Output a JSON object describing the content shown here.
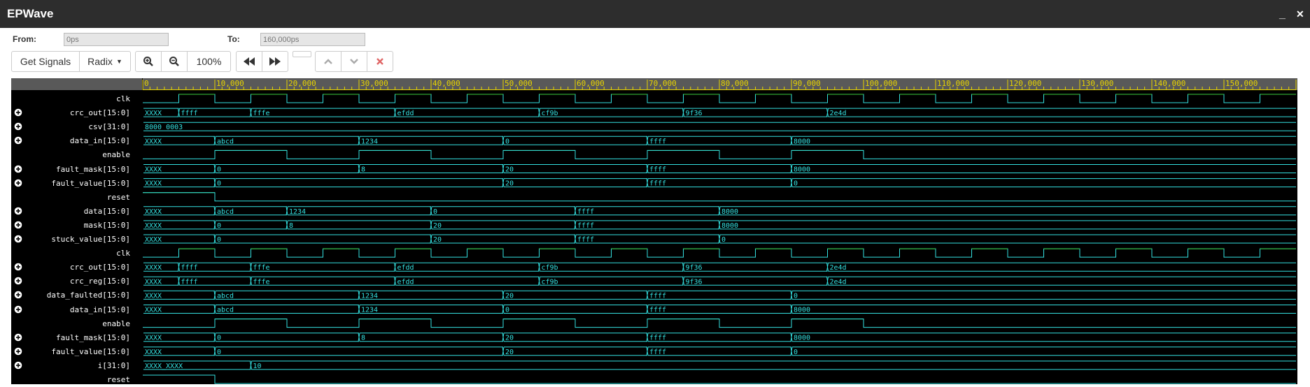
{
  "window": {
    "title": "EPWave",
    "minimize_label": "_",
    "close_label": "✕"
  },
  "range": {
    "from_label": "From:",
    "from_value": "0ps",
    "to_label": "To:",
    "to_value": "160,000ps"
  },
  "toolbar": {
    "get_signals_label": "Get Signals",
    "radix_label": "Radix",
    "zoom_level": "100%",
    "icons": [
      "zoom-in-icon",
      "zoom-out-icon",
      "rewind-icon",
      "fast-forward-icon",
      "up-icon",
      "down-icon",
      "remove-icon"
    ]
  },
  "time_axis": {
    "unit": "ps",
    "start": 0,
    "end": 160000,
    "major_step": 10000,
    "labels": [
      "0",
      "10,000",
      "20,000",
      "30,000",
      "40,000",
      "50,000",
      "60,000",
      "70,000",
      "80,000",
      "90,000",
      "100,000",
      "110,000",
      "120,000",
      "130,000",
      "140,000",
      "150,000"
    ]
  },
  "colors": {
    "wave": "#34e0e0",
    "bus_text": "#34e0e0",
    "logic_high": "#3ccc3c",
    "name_text": "#ffffff",
    "axis_tick": "#e8d400",
    "background": "#000000",
    "axis_bar": "#595959"
  },
  "signals": [
    {
      "name": "clk",
      "expandable": false,
      "type": "clock"
    },
    {
      "name": "crc_out[15:0]",
      "expandable": true,
      "type": "bus",
      "segments": [
        [
          0,
          "XXXX"
        ],
        [
          5000,
          "ffff"
        ],
        [
          15000,
          "fffe"
        ],
        [
          35000,
          "efdd"
        ],
        [
          55000,
          "cf9b"
        ],
        [
          75000,
          "9f36"
        ],
        [
          95000,
          "2e4d"
        ]
      ]
    },
    {
      "name": "csv[31:0]",
      "expandable": true,
      "type": "bus",
      "segments": [
        [
          0,
          "8000_0003"
        ]
      ]
    },
    {
      "name": "data_in[15:0]",
      "expandable": true,
      "type": "bus",
      "segments": [
        [
          0,
          "XXXX"
        ],
        [
          10000,
          "abcd"
        ],
        [
          30000,
          "1234"
        ],
        [
          50000,
          "0"
        ],
        [
          70000,
          "ffff"
        ],
        [
          90000,
          "8000"
        ]
      ]
    },
    {
      "name": "enable",
      "expandable": false,
      "type": "bit",
      "edges": [
        [
          0,
          0
        ],
        [
          10000,
          1
        ],
        [
          20000,
          0
        ],
        [
          30000,
          1
        ],
        [
          40000,
          0
        ],
        [
          50000,
          1
        ],
        [
          60000,
          0
        ],
        [
          70000,
          1
        ],
        [
          80000,
          0
        ],
        [
          90000,
          1
        ],
        [
          100000,
          0
        ]
      ]
    },
    {
      "name": "fault_mask[15:0]",
      "expandable": true,
      "type": "bus",
      "segments": [
        [
          0,
          "XXXX"
        ],
        [
          10000,
          "0"
        ],
        [
          30000,
          "8"
        ],
        [
          50000,
          "20"
        ],
        [
          70000,
          "ffff"
        ],
        [
          90000,
          "8000"
        ]
      ]
    },
    {
      "name": "fault_value[15:0]",
      "expandable": true,
      "type": "bus",
      "segments": [
        [
          0,
          "XXXX"
        ],
        [
          10000,
          "0"
        ],
        [
          50000,
          "20"
        ],
        [
          70000,
          "ffff"
        ],
        [
          90000,
          "0"
        ]
      ]
    },
    {
      "name": "reset",
      "expandable": false,
      "type": "bit",
      "edges": [
        [
          0,
          1
        ],
        [
          10000,
          0
        ]
      ]
    },
    {
      "name": "data[15:0]",
      "expandable": true,
      "type": "bus",
      "segments": [
        [
          0,
          "XXXX"
        ],
        [
          10000,
          "abcd"
        ],
        [
          20000,
          "1234"
        ],
        [
          40000,
          "0"
        ],
        [
          60000,
          "ffff"
        ],
        [
          80000,
          "8000"
        ]
      ]
    },
    {
      "name": "mask[15:0]",
      "expandable": true,
      "type": "bus",
      "segments": [
        [
          0,
          "XXXX"
        ],
        [
          10000,
          "0"
        ],
        [
          20000,
          "8"
        ],
        [
          40000,
          "20"
        ],
        [
          60000,
          "ffff"
        ],
        [
          80000,
          "8000"
        ]
      ]
    },
    {
      "name": "stuck_value[15:0]",
      "expandable": true,
      "type": "bus",
      "segments": [
        [
          0,
          "XXXX"
        ],
        [
          10000,
          "0"
        ],
        [
          40000,
          "20"
        ],
        [
          60000,
          "ffff"
        ],
        [
          80000,
          "0"
        ]
      ]
    },
    {
      "name": "clk",
      "expandable": false,
      "type": "clock"
    },
    {
      "name": "crc_out[15:0]",
      "expandable": true,
      "type": "bus",
      "segments": [
        [
          0,
          "XXXX"
        ],
        [
          5000,
          "ffff"
        ],
        [
          15000,
          "fffe"
        ],
        [
          35000,
          "efdd"
        ],
        [
          55000,
          "cf9b"
        ],
        [
          75000,
          "9f36"
        ],
        [
          95000,
          "2e4d"
        ]
      ]
    },
    {
      "name": "crc_reg[15:0]",
      "expandable": true,
      "type": "bus",
      "segments": [
        [
          0,
          "XXXX"
        ],
        [
          5000,
          "ffff"
        ],
        [
          15000,
          "fffe"
        ],
        [
          35000,
          "efdd"
        ],
        [
          55000,
          "cf9b"
        ],
        [
          75000,
          "9f36"
        ],
        [
          95000,
          "2e4d"
        ]
      ]
    },
    {
      "name": "data_faulted[15:0]",
      "expandable": true,
      "type": "bus",
      "segments": [
        [
          0,
          "XXXX"
        ],
        [
          10000,
          "abcd"
        ],
        [
          30000,
          "1234"
        ],
        [
          50000,
          "20"
        ],
        [
          70000,
          "ffff"
        ],
        [
          90000,
          "0"
        ]
      ]
    },
    {
      "name": "data_in[15:0]",
      "expandable": true,
      "type": "bus",
      "segments": [
        [
          0,
          "XXXX"
        ],
        [
          10000,
          "abcd"
        ],
        [
          30000,
          "1234"
        ],
        [
          50000,
          "0"
        ],
        [
          70000,
          "ffff"
        ],
        [
          90000,
          "8000"
        ]
      ]
    },
    {
      "name": "enable",
      "expandable": false,
      "type": "bit",
      "edges": [
        [
          0,
          0
        ],
        [
          10000,
          1
        ],
        [
          20000,
          0
        ],
        [
          30000,
          1
        ],
        [
          40000,
          0
        ],
        [
          50000,
          1
        ],
        [
          60000,
          0
        ],
        [
          70000,
          1
        ],
        [
          80000,
          0
        ],
        [
          90000,
          1
        ],
        [
          100000,
          0
        ]
      ]
    },
    {
      "name": "fault_mask[15:0]",
      "expandable": true,
      "type": "bus",
      "segments": [
        [
          0,
          "XXXX"
        ],
        [
          10000,
          "0"
        ],
        [
          30000,
          "8"
        ],
        [
          50000,
          "20"
        ],
        [
          70000,
          "ffff"
        ],
        [
          90000,
          "8000"
        ]
      ]
    },
    {
      "name": "fault_value[15:0]",
      "expandable": true,
      "type": "bus",
      "segments": [
        [
          0,
          "XXXX"
        ],
        [
          10000,
          "0"
        ],
        [
          50000,
          "20"
        ],
        [
          70000,
          "ffff"
        ],
        [
          90000,
          "0"
        ]
      ]
    },
    {
      "name": "i[31:0]",
      "expandable": true,
      "type": "bus",
      "segments": [
        [
          0,
          "XXXX_XXXX"
        ],
        [
          15000,
          "10"
        ]
      ]
    },
    {
      "name": "reset",
      "expandable": false,
      "type": "bit",
      "edges": [
        [
          0,
          1
        ],
        [
          10000,
          0
        ]
      ]
    }
  ]
}
